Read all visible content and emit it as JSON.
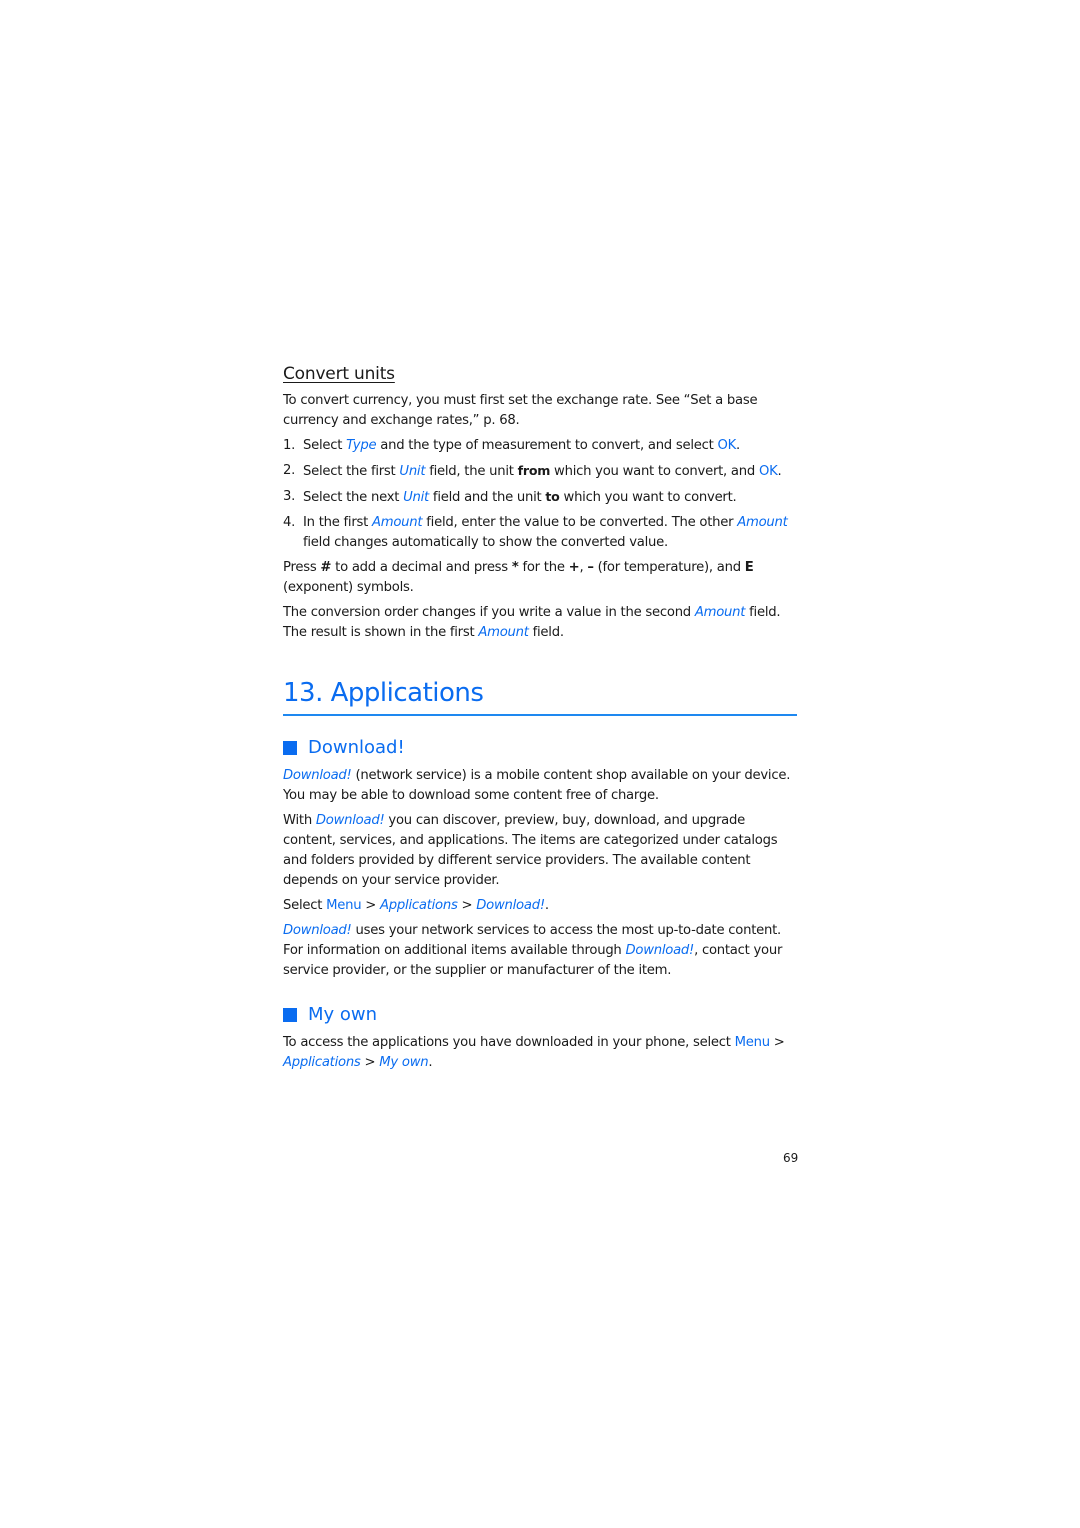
{
  "convert_units": {
    "title": "Convert units",
    "intro": {
      "text": "To convert currency, you must first set the exchange rate. See “Set a base currency and exchange rates,” p. 68."
    },
    "steps": [
      {
        "num": "1.",
        "parts": [
          "Select ",
          "Type",
          " and the type of measurement to convert, and select ",
          "OK",
          "."
        ]
      },
      {
        "num": "2.",
        "parts": [
          "Select the first ",
          "Unit",
          " field, the unit ",
          "from",
          " which you want to convert, and ",
          "OK",
          "."
        ]
      },
      {
        "num": "3.",
        "parts": [
          "Select the next ",
          "Unit",
          " field and the unit ",
          "to",
          " which you want to convert."
        ]
      },
      {
        "num": "4.",
        "parts": [
          "In the first ",
          "Amount",
          " field, enter the value to be converted. The other ",
          "Amount",
          " field changes automatically to show the converted value."
        ]
      }
    ],
    "press_note": {
      "parts": [
        "Press ",
        "#",
        " to add a decimal and press ",
        "*",
        " for the ",
        "+",
        ", ",
        "–",
        " (for temperature), and ",
        "E",
        " (exponent) symbols."
      ]
    },
    "order_note": {
      "parts": [
        "The conversion order changes if you write a value in the second ",
        "Amount",
        " field. The result is shown in the first ",
        "Amount",
        " field."
      ]
    }
  },
  "chapter": {
    "title": "13. Applications"
  },
  "download_section": {
    "title": "Download!",
    "para1": {
      "parts": [
        "Download!",
        " (network service) is a mobile content shop available on your device. You may be able to download some content free of charge."
      ]
    },
    "para2": {
      "parts": [
        "With ",
        "Download!",
        " you can discover, preview, buy, download, and upgrade content, services, and applications. The items are categorized under catalogs and folders provided by different service providers. The available content depends on your service provider."
      ]
    },
    "path": {
      "parts": [
        "Select ",
        "Menu",
        " > ",
        "Applications",
        " > ",
        "Download!",
        "."
      ]
    },
    "para3": {
      "parts": [
        "Download!",
        " uses your network services to access the most up-to-date content. For information on additional items available through ",
        "Download!",
        ", contact your service provider, or the supplier or manufacturer of the item."
      ]
    }
  },
  "my_own_section": {
    "title": "My own",
    "para": {
      "parts": [
        "To access the applications you have downloaded in your phone, select ",
        "Menu",
        " > ",
        "Applications",
        " > ",
        "My own",
        "."
      ]
    }
  },
  "footer": {
    "page_number": "69"
  },
  "colors": {
    "accent": "#0a6cf0",
    "rule": "#1e88f0",
    "text": "#1a1a1a"
  }
}
